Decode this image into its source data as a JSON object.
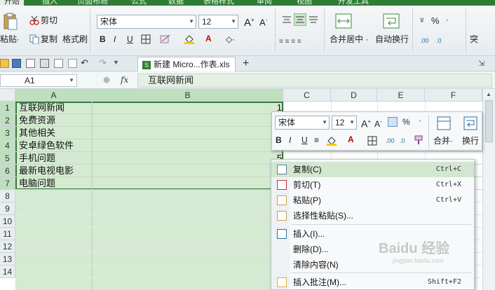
{
  "ribbon_tabs": [
    "开始",
    "插入",
    "页面布局",
    "公式",
    "数据",
    "表格样式",
    "审阅",
    "视图",
    "开发工具"
  ],
  "clipboard": {
    "paste": "粘贴",
    "cut": "剪切",
    "copy": "复制",
    "format_painter": "格式刷"
  },
  "font": {
    "name": "宋体",
    "size": "12"
  },
  "format_buttons": {
    "bold": "B",
    "italic": "I",
    "underline": "U",
    "grow": "A⁺",
    "shrink": "A⁻"
  },
  "merge": {
    "label": "合并居中",
    "wrap": "自动换行",
    "percent": "%",
    "more": "突"
  },
  "doc_tab": "新建 Micro...作表.xls *",
  "add_tab": "+",
  "name_box": "A1",
  "fx": "fx",
  "formula_value": "互联网新闻",
  "columns": [
    "A",
    "B",
    "C",
    "D",
    "E",
    "F"
  ],
  "rows": [
    "1",
    "2",
    "3",
    "4",
    "5",
    "6",
    "7",
    "8",
    "9",
    "10",
    "11",
    "12",
    "13",
    "14"
  ],
  "cells": [
    {
      "a": "互联网新闻",
      "b": "1"
    },
    {
      "a": "免费资源",
      "b": ""
    },
    {
      "a": "其他相关",
      "b": ""
    },
    {
      "a": "安卓绿色软件",
      "b": ""
    },
    {
      "a": "手机问题",
      "b": "5"
    },
    {
      "a": "最新电视电影",
      "b": ""
    },
    {
      "a": "电脑问题",
      "b": ""
    }
  ],
  "mini_toolbar": {
    "font": "宋体",
    "size": "12",
    "bold": "B",
    "italic": "I",
    "underline": "U",
    "merge": "合并",
    "wrap": "换行",
    "percent": "%"
  },
  "context_menu": [
    {
      "label": "复制(C)",
      "shortcut": "Ctrl+C",
      "icon": "copy-icon",
      "highlight": true
    },
    {
      "label": "剪切(T)",
      "shortcut": "Ctrl+X",
      "icon": "scissors-icon"
    },
    {
      "label": "粘贴(P)",
      "shortcut": "Ctrl+V",
      "icon": "paste-icon"
    },
    {
      "label": "选择性粘贴(S)...",
      "shortcut": "",
      "icon": "paste-special-icon"
    },
    {
      "label": "插入(I)...",
      "shortcut": "",
      "icon": "insert-icon"
    },
    {
      "label": "删除(D)...",
      "shortcut": "",
      "icon": ""
    },
    {
      "label": "清除内容(N)",
      "shortcut": "",
      "icon": ""
    },
    {
      "label": "插入批注(M)...",
      "shortcut": "Shift+F2",
      "icon": "comment-icon"
    }
  ],
  "colors": {
    "accent": "#2e7d32",
    "selection": "#d4ead1",
    "header_sel": "#bfe0bf",
    "menu_hl": "#d3e6d0"
  },
  "watermark": "Baidu 经验",
  "watermark_url": "jingyan.baidu.com"
}
